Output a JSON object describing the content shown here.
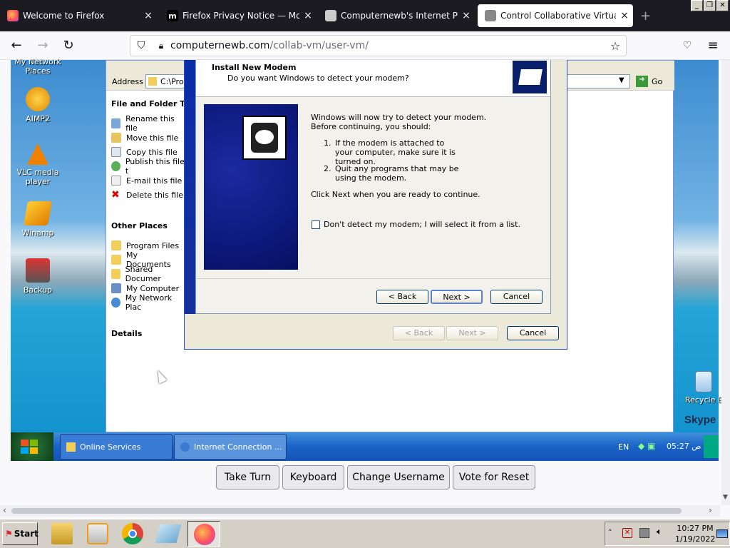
{
  "browser": {
    "tabs": [
      {
        "title": "Welcome to Firefox",
        "close": "×"
      },
      {
        "title": "Firefox Privacy Notice — Mozilla",
        "close": "×"
      },
      {
        "title": "Computernewb's Internet Pub Hub",
        "close": "×"
      },
      {
        "title": "Control Collaborative Virtual Machi",
        "close": "×"
      }
    ],
    "new_tab": "+",
    "url_host": "computernewb.com",
    "url_path": "/collab-vm/user-vm/",
    "window_buttons": [
      "_",
      "❐",
      "✕"
    ]
  },
  "desktop": {
    "icons": [
      {
        "label": "My Network Places"
      },
      {
        "label": "AIMP2"
      },
      {
        "label": "VLC media player"
      },
      {
        "label": "Winamp"
      },
      {
        "label": "Backup"
      },
      {
        "label": "Recycle B"
      }
    ],
    "skype_label": "Skype"
  },
  "explorer": {
    "address_label": "Address",
    "address_value": "C:\\Pro",
    "go_label": "Go",
    "file_tasks_title": "File and Folder Tas",
    "file_tasks": [
      "Rename this file",
      "Move this file",
      "Copy this file",
      "Publish this file t",
      "E-mail this file",
      "Delete this file"
    ],
    "other_places_title": "Other Places",
    "other_places": [
      "Program Files",
      "My Documents",
      "Shared Documer",
      "My Computer",
      "My Network Plac"
    ],
    "details_title": "Details"
  },
  "wizard": {
    "title": "Install New Modem",
    "subtitle": "Do you want Windows to detect your modem?",
    "intro": "Windows will now try to detect your modem.  Before continuing, you should:",
    "step1_num": "1.",
    "step1": "If the modem is attached to your computer, make sure it is turned on.",
    "step2_num": "2.",
    "step2": "Quit any programs that may be using the modem.",
    "click_next": "Click Next when you are ready to continue.",
    "checkbox_label": "Don't detect my modem; I will select it from a list.",
    "back": "< Back",
    "next": "Next >",
    "cancel": "Cancel",
    "outer_back": "< Back",
    "outer_next": "Next >",
    "outer_cancel": "Cancel"
  },
  "vm_taskbar": {
    "buttons": [
      "Online Services",
      "Internet Connection ..."
    ],
    "lang": "EN",
    "clock": "05:27 ص"
  },
  "page_controls": [
    "Take Turn",
    "Keyboard",
    "Change Username",
    "Vote for Reset"
  ],
  "host_taskbar": {
    "start": "Start",
    "time": "10:27 PM",
    "date": "1/19/2022",
    "tray_arrow": "˄"
  }
}
